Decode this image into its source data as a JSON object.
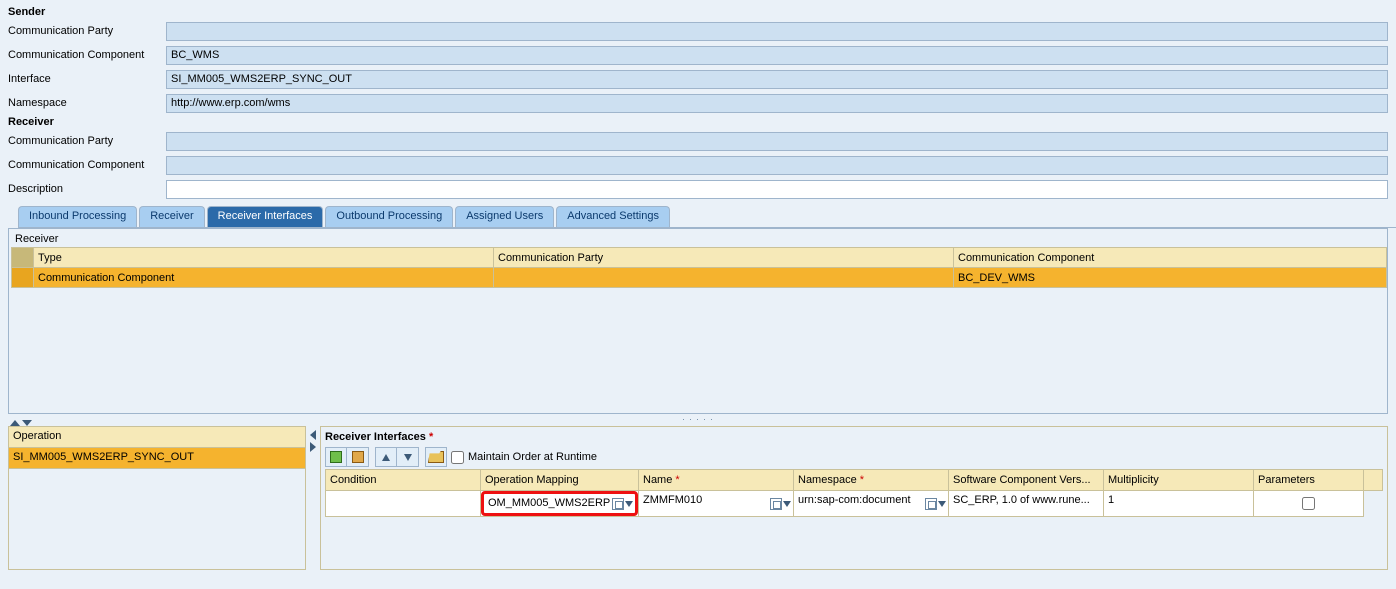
{
  "sender": {
    "header": "Sender",
    "party_label": "Communication Party",
    "party_value": "",
    "component_label": "Communication Component",
    "component_value": "BC_WMS",
    "interface_label": "Interface",
    "interface_value": "SI_MM005_WMS2ERP_SYNC_OUT",
    "namespace_label": "Namespace",
    "namespace_value": "http://www.erp.com/wms"
  },
  "receiver": {
    "header": "Receiver",
    "party_label": "Communication Party",
    "party_value": "",
    "component_label": "Communication Component",
    "component_value": "",
    "description_label": "Description",
    "description_value": ""
  },
  "tabs": {
    "inbound": "Inbound Processing",
    "receiver": "Receiver",
    "receiver_interfaces": "Receiver Interfaces",
    "outbound": "Outbound Processing",
    "assigned_users": "Assigned Users",
    "advanced": "Advanced Settings"
  },
  "receiver_table": {
    "title": "Receiver",
    "col_type": "Type",
    "col_party": "Communication Party",
    "col_component": "Communication Component",
    "row": {
      "type": "Communication Component",
      "party": "",
      "component": "BC_DEV_WMS"
    }
  },
  "operation": {
    "header": "Operation",
    "row": "SI_MM005_WMS2ERP_SYNC_OUT"
  },
  "ri": {
    "title": "Receiver Interfaces",
    "maintain_label": "Maintain Order at Runtime",
    "cols": {
      "condition": "Condition",
      "opmap": "Operation Mapping",
      "name": "Name",
      "namespace": "Namespace",
      "swcv": "Software Component Vers...",
      "multiplicity": "Multiplicity",
      "parameters": "Parameters"
    },
    "row": {
      "condition": "",
      "opmap": "OM_MM005_WMS2ERP",
      "name": "ZMMFM010",
      "namespace": "urn:sap-com:document",
      "swcv": "SC_ERP, 1.0 of www.rune...",
      "multiplicity": "1"
    }
  }
}
